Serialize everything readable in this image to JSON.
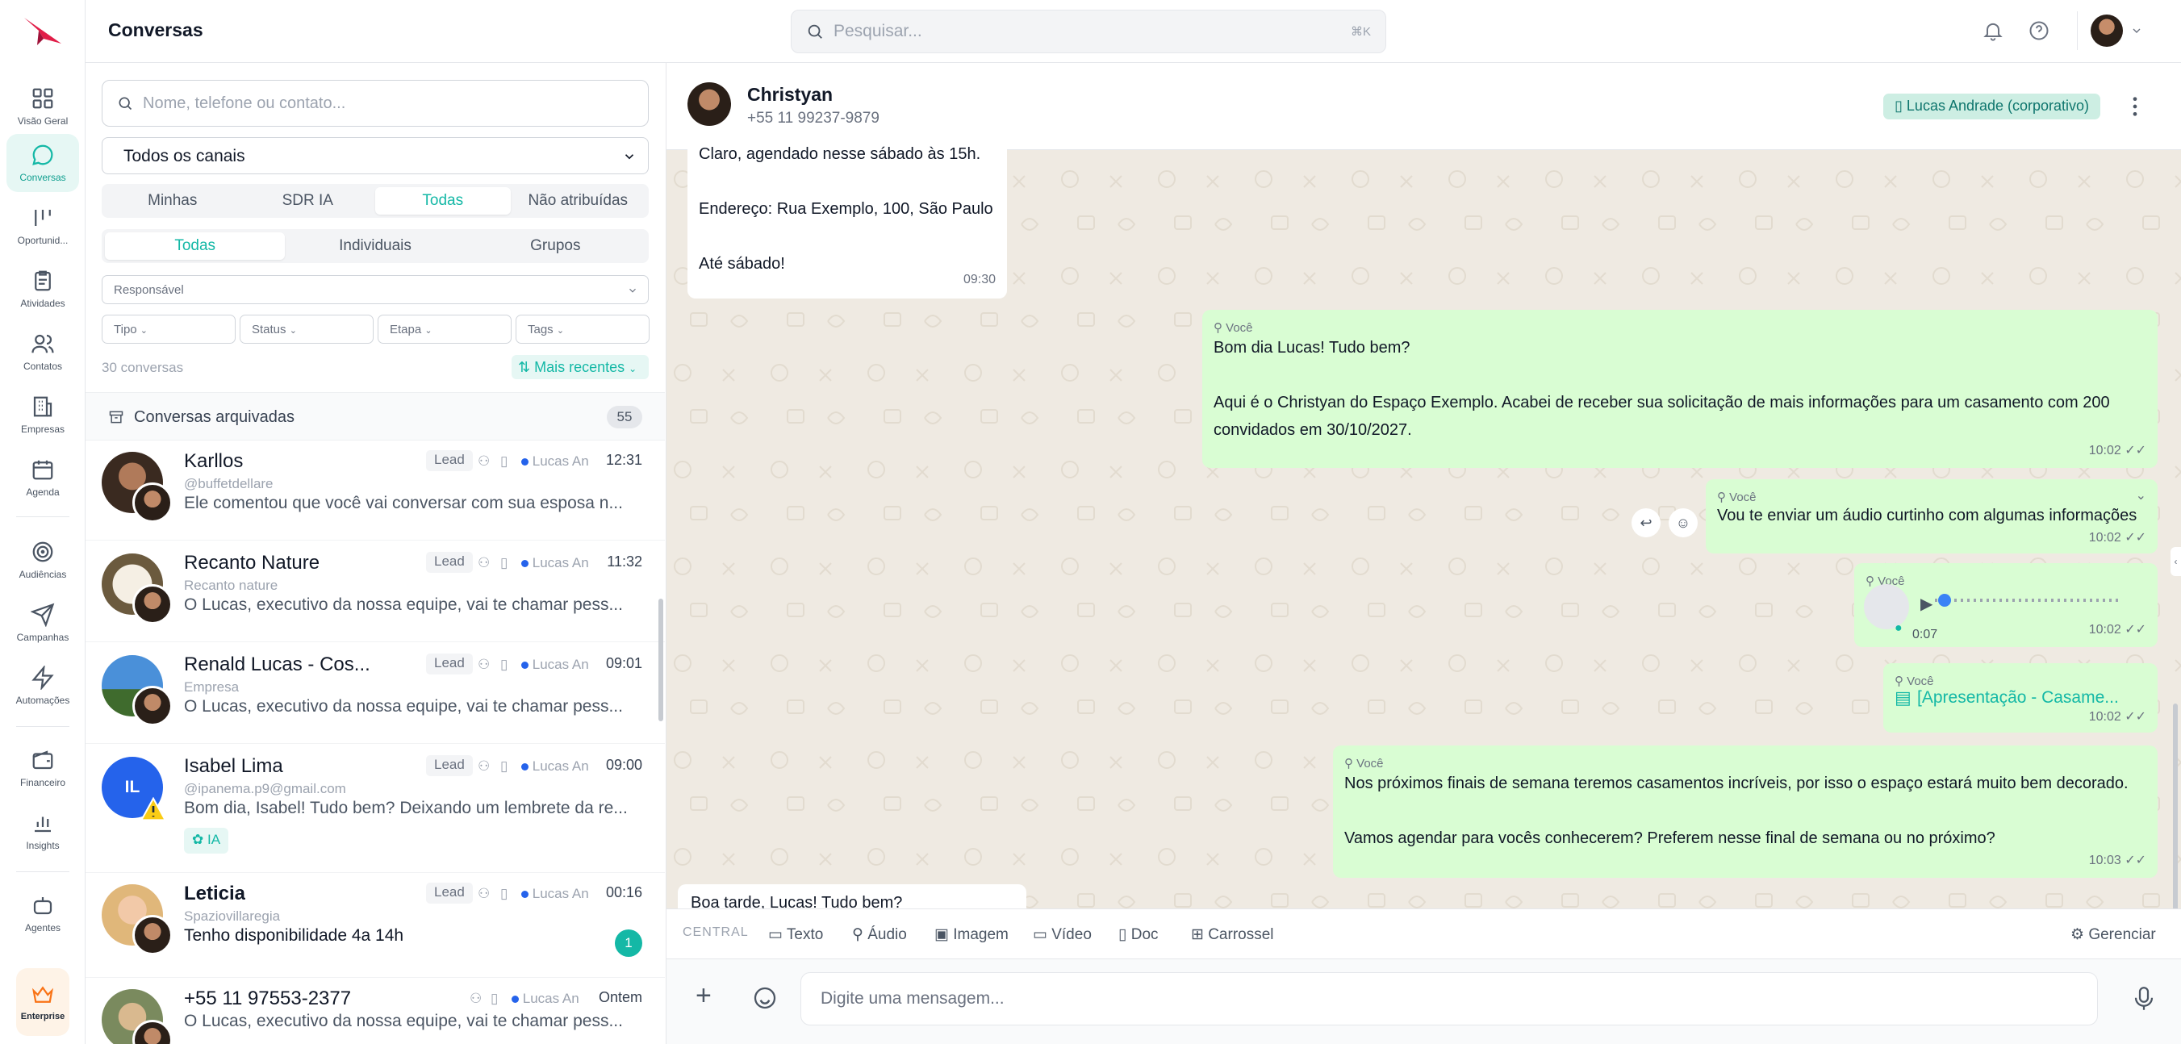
{
  "colors": {
    "accent": "#14b8a6",
    "brand": "#e11d48",
    "outgoing_bubble": "#d9fdd3",
    "chat_bg": "#efeae2"
  },
  "rail": {
    "items": [
      {
        "label": "Visão Geral",
        "icon": "grid-icon"
      },
      {
        "label": "Conversas",
        "icon": "chat-bubble-icon"
      },
      {
        "label": "Oportunid...",
        "icon": "kanban-icon"
      },
      {
        "label": "Atividades",
        "icon": "clipboard-icon"
      },
      {
        "label": "Contatos",
        "icon": "users-icon"
      },
      {
        "label": "Empresas",
        "icon": "building-icon"
      },
      {
        "label": "Agenda",
        "icon": "calendar-icon"
      },
      {
        "label": "Audiências",
        "icon": "target-icon"
      },
      {
        "label": "Campanhas",
        "icon": "send-icon"
      },
      {
        "label": "Automações",
        "icon": "bolt-icon"
      },
      {
        "label": "Financeiro",
        "icon": "wallet-icon"
      },
      {
        "label": "Insights",
        "icon": "bar-chart-icon"
      },
      {
        "label": "Agentes",
        "icon": "bot-icon"
      }
    ],
    "plan": {
      "label": "Enterprise",
      "icon": "crown-icon"
    }
  },
  "header": {
    "title": "Conversas",
    "search_placeholder": "Pesquisar...",
    "search_shortcut": "⌘K"
  },
  "list": {
    "search_placeholder": "Nome, telefone ou contato...",
    "channel": "Todos os canais",
    "scope_tabs": [
      "Minhas",
      "SDR IA",
      "Todas",
      "Não atribuídas"
    ],
    "scope_active": "Todas",
    "type_tabs": [
      "Todas",
      "Individuais",
      "Grupos"
    ],
    "type_active": "Todas",
    "filters": {
      "responsavel": "Responsável",
      "tipo": "Tipo",
      "status": "Status",
      "etapa": "Etapa",
      "tags": "Tags"
    },
    "count": "30 conversas",
    "sort": "Mais recentes",
    "archived": {
      "label": "Conversas arquivadas",
      "count": "55"
    },
    "conversations": [
      {
        "name": "Karllos",
        "sub": "@buffetdellare",
        "preview": "Ele comentou que você vai conversar com sua esposa n...",
        "tag": "Lead",
        "agent": "Lucas An",
        "time": "12:31"
      },
      {
        "name": "Recanto Nature",
        "sub": "Recanto nature",
        "preview": "O Lucas, executivo da nossa equipe, vai te chamar pess...",
        "tag": "Lead",
        "agent": "Lucas An",
        "time": "11:32"
      },
      {
        "name": "Renald Lucas - Cos...",
        "sub": "Empresa",
        "preview": "O Lucas, executivo da nossa equipe, vai te chamar pess...",
        "tag": "Lead",
        "agent": "Lucas An",
        "time": "09:01"
      },
      {
        "name": "Isabel Lima",
        "initials": "IL",
        "sub": "@ipanema.p9@gmail.com",
        "preview": "Bom dia, Isabel! Tudo bem? Deixando um lembrete da re...",
        "tag": "Lead",
        "agent": "Lucas An",
        "time": "09:00",
        "ai_badge": "IA"
      },
      {
        "name": "Leticia",
        "sub": "Spaziovillaregia",
        "preview": "Tenho disponibilidade 4a 14h",
        "tag": "Lead",
        "agent": "Lucas An",
        "time": "00:16",
        "unread": "1"
      },
      {
        "name": "+55 11 97553-2377",
        "sub": "",
        "preview": "O Lucas, executivo da nossa equipe, vai te chamar pess...",
        "tag": "",
        "agent": "Lucas An",
        "time": "Ontem"
      }
    ]
  },
  "chat": {
    "contact_name": "Christyan",
    "contact_phone": "+55 11 99237-9879",
    "channel": "Lucas Andrade (corporativo)",
    "messages": [
      {
        "dir": "in",
        "lines": [
          "Claro, agendado nesse sábado às 15h.",
          "",
          "Endereço: Rua Exemplo, 100, São Paulo",
          "",
          "Até sábado!"
        ],
        "time": "09:30"
      },
      {
        "dir": "out",
        "author": "Você",
        "lines": [
          "Bom dia Lucas! Tudo bem?",
          "",
          "Aqui é o Christyan do Espaço Exemplo. Acabei de receber sua solicitação de mais informações para um casamento com 200",
          "convidados em 30/10/2027."
        ],
        "time": "10:02 ✓✓"
      },
      {
        "dir": "out",
        "author": "Você",
        "lines": [
          "Vou te enviar um áudio curtinho com algumas informações"
        ],
        "time": "10:02 ✓✓"
      },
      {
        "dir": "out",
        "author": "Você",
        "audio_duration": "0:07",
        "time": "10:02 ✓✓"
      },
      {
        "dir": "out",
        "author": "Você",
        "file": "[Apresentação - Casame...",
        "time": "10:02 ✓✓"
      },
      {
        "dir": "out",
        "author": "Você",
        "lines": [
          "Nos próximos finais de semana teremos casamentos incríveis, por isso o espaço estará muito bem decorado.",
          "",
          "Vamos agendar para vocês conhecerem? Preferem nesse final de semana ou no próximo?"
        ],
        "time": "10:03 ✓✓"
      },
      {
        "dir": "in",
        "lines": [
          "Boa tarde, Lucas! Tudo bem?"
        ]
      }
    ],
    "composer": {
      "channel_label": "CENTRAL",
      "tools": [
        "Texto",
        "Áudio",
        "Imagem",
        "Vídeo",
        "Doc",
        "Carrossel"
      ],
      "manage": "Gerenciar",
      "placeholder": "Digite uma mensagem..."
    }
  }
}
